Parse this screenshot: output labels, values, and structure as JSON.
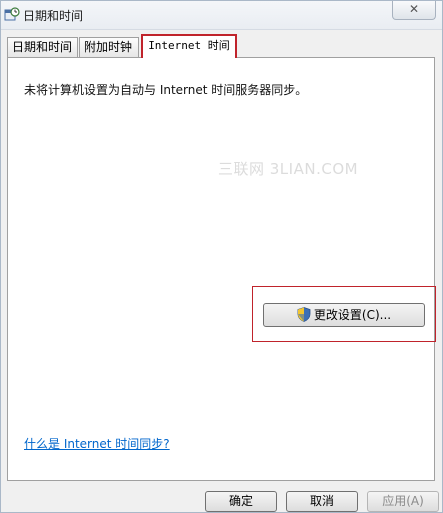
{
  "window": {
    "title": "日期和时间",
    "close_label": "✕"
  },
  "tabs": [
    {
      "label": "日期和时间"
    },
    {
      "label": "附加时钟"
    },
    {
      "label": "Internet 时间",
      "active": true
    }
  ],
  "panel": {
    "status": "未将计算机设置为自动与 Internet 时间服务器同步。",
    "watermark": "三联网 3LIAN.COM",
    "change_button": "更改设置(C)...",
    "help_link": "什么是 Internet 时间同步?"
  },
  "buttons": {
    "ok": "确定",
    "cancel": "取消",
    "apply": "应用(A)"
  },
  "colors": {
    "highlight": "#c0232b",
    "link": "#0066cc"
  }
}
